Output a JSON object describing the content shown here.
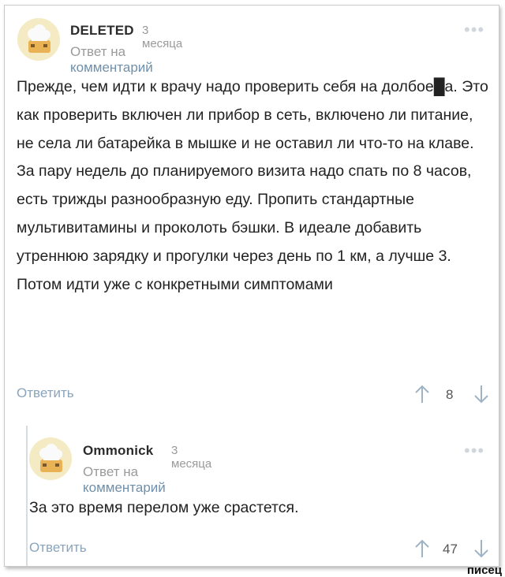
{
  "comments": [
    {
      "author": "DELETED",
      "time": "3 месяца",
      "reply_prefix": "Ответ на",
      "reply_link": "комментарий",
      "menu_dots": "•••",
      "body": "Прежде, чем идти к врачу надо проверить себя на долбое█а. Это как проверить включен ли прибор в сеть, включено ли питание, не села ли батарейка в мышке и не оставил ли что-то на клаве. За пару недель до планируемого визита надо спать по 8 часов, есть трижды разнообразную еду. Пропить стандартные мультивитамины и проколоть бэшки. В идеале добавить утреннюю зарядку и прогулки через день по 1 км, а лучше 3. Потом идти уже с конкретными симптомами",
      "answer_label": "Ответить",
      "score": "8"
    },
    {
      "author": "Ommonick",
      "time": "3 месяца",
      "reply_prefix": "Ответ на",
      "reply_link": "комментарий",
      "menu_dots": "•••",
      "body": "За это время перелом уже срастется.",
      "answer_label": "Ответить",
      "score": "47"
    }
  ],
  "watermark": "писец",
  "colors": {
    "link": "#6f8faa",
    "answer": "#8aa4bb",
    "muted": "#9a9a9a",
    "avatar_bg": "#f4ebc4",
    "avatar_face": "#e9b355",
    "arrow": "#9fb3c4"
  },
  "icons": {
    "avatar": "chef-toast-avatar-icon",
    "menu": "more-dots-icon",
    "up": "arrow-up-icon",
    "down": "arrow-down-icon"
  }
}
